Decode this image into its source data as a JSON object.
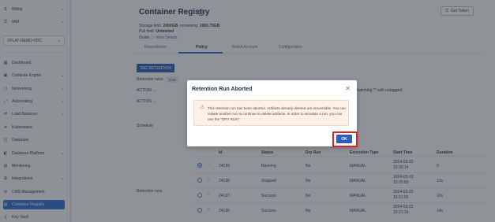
{
  "sidebar": {
    "top_items": [
      {
        "label": "Billing",
        "icon": "dollar-icon"
      },
      {
        "label": "IAM",
        "icon": "user-key-icon"
      }
    ],
    "project_select": {
      "value": "XPLAT-DEMO-VDC"
    },
    "items": [
      {
        "label": "Dashboard",
        "icon": "dashboard-icon",
        "chevron": false
      },
      {
        "label": "Compute Engine",
        "icon": "compute-icon",
        "chevron": true
      },
      {
        "label": "Networking",
        "icon": "network-icon",
        "chevron": true
      },
      {
        "label": "Autoscaling",
        "icon": "autoscale-icon",
        "chevron": true
      },
      {
        "label": "Load Balancer",
        "icon": "load-balancer-icon",
        "chevron": true
      },
      {
        "label": "Kubernetes",
        "icon": "kubernetes-icon",
        "chevron": false
      },
      {
        "label": "Database",
        "icon": "database-icon",
        "chevron": false
      },
      {
        "label": "Database Platform",
        "icon": "database-platform-icon",
        "chevron": true
      },
      {
        "label": "Monitoring",
        "icon": "monitoring-icon",
        "chevron": false
      },
      {
        "label": "Integrations",
        "icon": "integrations-icon",
        "chevron": true
      },
      {
        "label": "CMS Management",
        "icon": "cms-icon",
        "chevron": false
      },
      {
        "label": "Container Registry",
        "icon": "container-icon",
        "chevron": false,
        "active": true
      },
      {
        "label": "Key Vault",
        "icon": "key-icon",
        "chevron": false
      }
    ]
  },
  "header": {
    "title": "Container Registry",
    "storage_label": "Storage limit:",
    "storage_limit": "2000GB",
    "storage_remaining_label": ", remaining:",
    "storage_remaining": "1983.75GB",
    "pull_limit_label": "Pull limit:",
    "pull_limit": "Unlimited",
    "guide_label": "Guide",
    "view_details": "View Details",
    "get_token": "Get Token"
  },
  "tabs": [
    "Repositories",
    "Policy",
    "Robot Account",
    "Configuration"
  ],
  "policy": {
    "tag_retention_button": "TAG RETENTION",
    "retention_rules_label": "Retention rules",
    "retention_rules_count": "2/16",
    "action1": "ACTION",
    "action2": "ACTION",
    "schedule_label": "Schedule",
    "retention_runs_label": "Retention runs",
    "matching_text": "matching ** with untagged"
  },
  "runs_table": {
    "headers": [
      "Id",
      "Status",
      "Dry Run",
      "Execution Type",
      "Start Time",
      "Duration"
    ],
    "rows": [
      {
        "id": "24139",
        "status": "Running",
        "dry_run": "No",
        "type": "MANUAL",
        "start_date": "2024-03-22",
        "start_time": "15:26:14",
        "duration": "0",
        "selected": true
      },
      {
        "id": "24138",
        "status": "Stopped",
        "dry_run": "No",
        "type": "MANUAL",
        "start_date": "2024-03-22",
        "start_time": "15:25:50",
        "duration": "12s",
        "selected": false
      },
      {
        "id": "24137",
        "status": "Success",
        "dry_run": "No",
        "type": "MANUAL",
        "start_date": "2024-03-22",
        "start_time": "15:21:55",
        "duration": "10s",
        "selected": false
      },
      {
        "id": "24136",
        "status": "Success",
        "dry_run": "No",
        "type": "MANUAL",
        "start_date": "2024-03-22",
        "start_time": "15:21:16",
        "duration": "14s",
        "selected": false
      }
    ]
  },
  "modal": {
    "title": "Retention Run Aborted",
    "message": "This retention run has been aborted. Artifacts already deleted are irreversible. You can initiate another run to continue to delete artifacts. In order to simulate a run, you can use the \"DRY RUN\".",
    "ok_label": "OK"
  },
  "colors": {
    "accent": "#2b6cd1",
    "primary_button": "#2b5fb8",
    "warning_bg": "#fdf1e7",
    "warning_icon": "#e0782a",
    "highlight": "#e02020"
  }
}
